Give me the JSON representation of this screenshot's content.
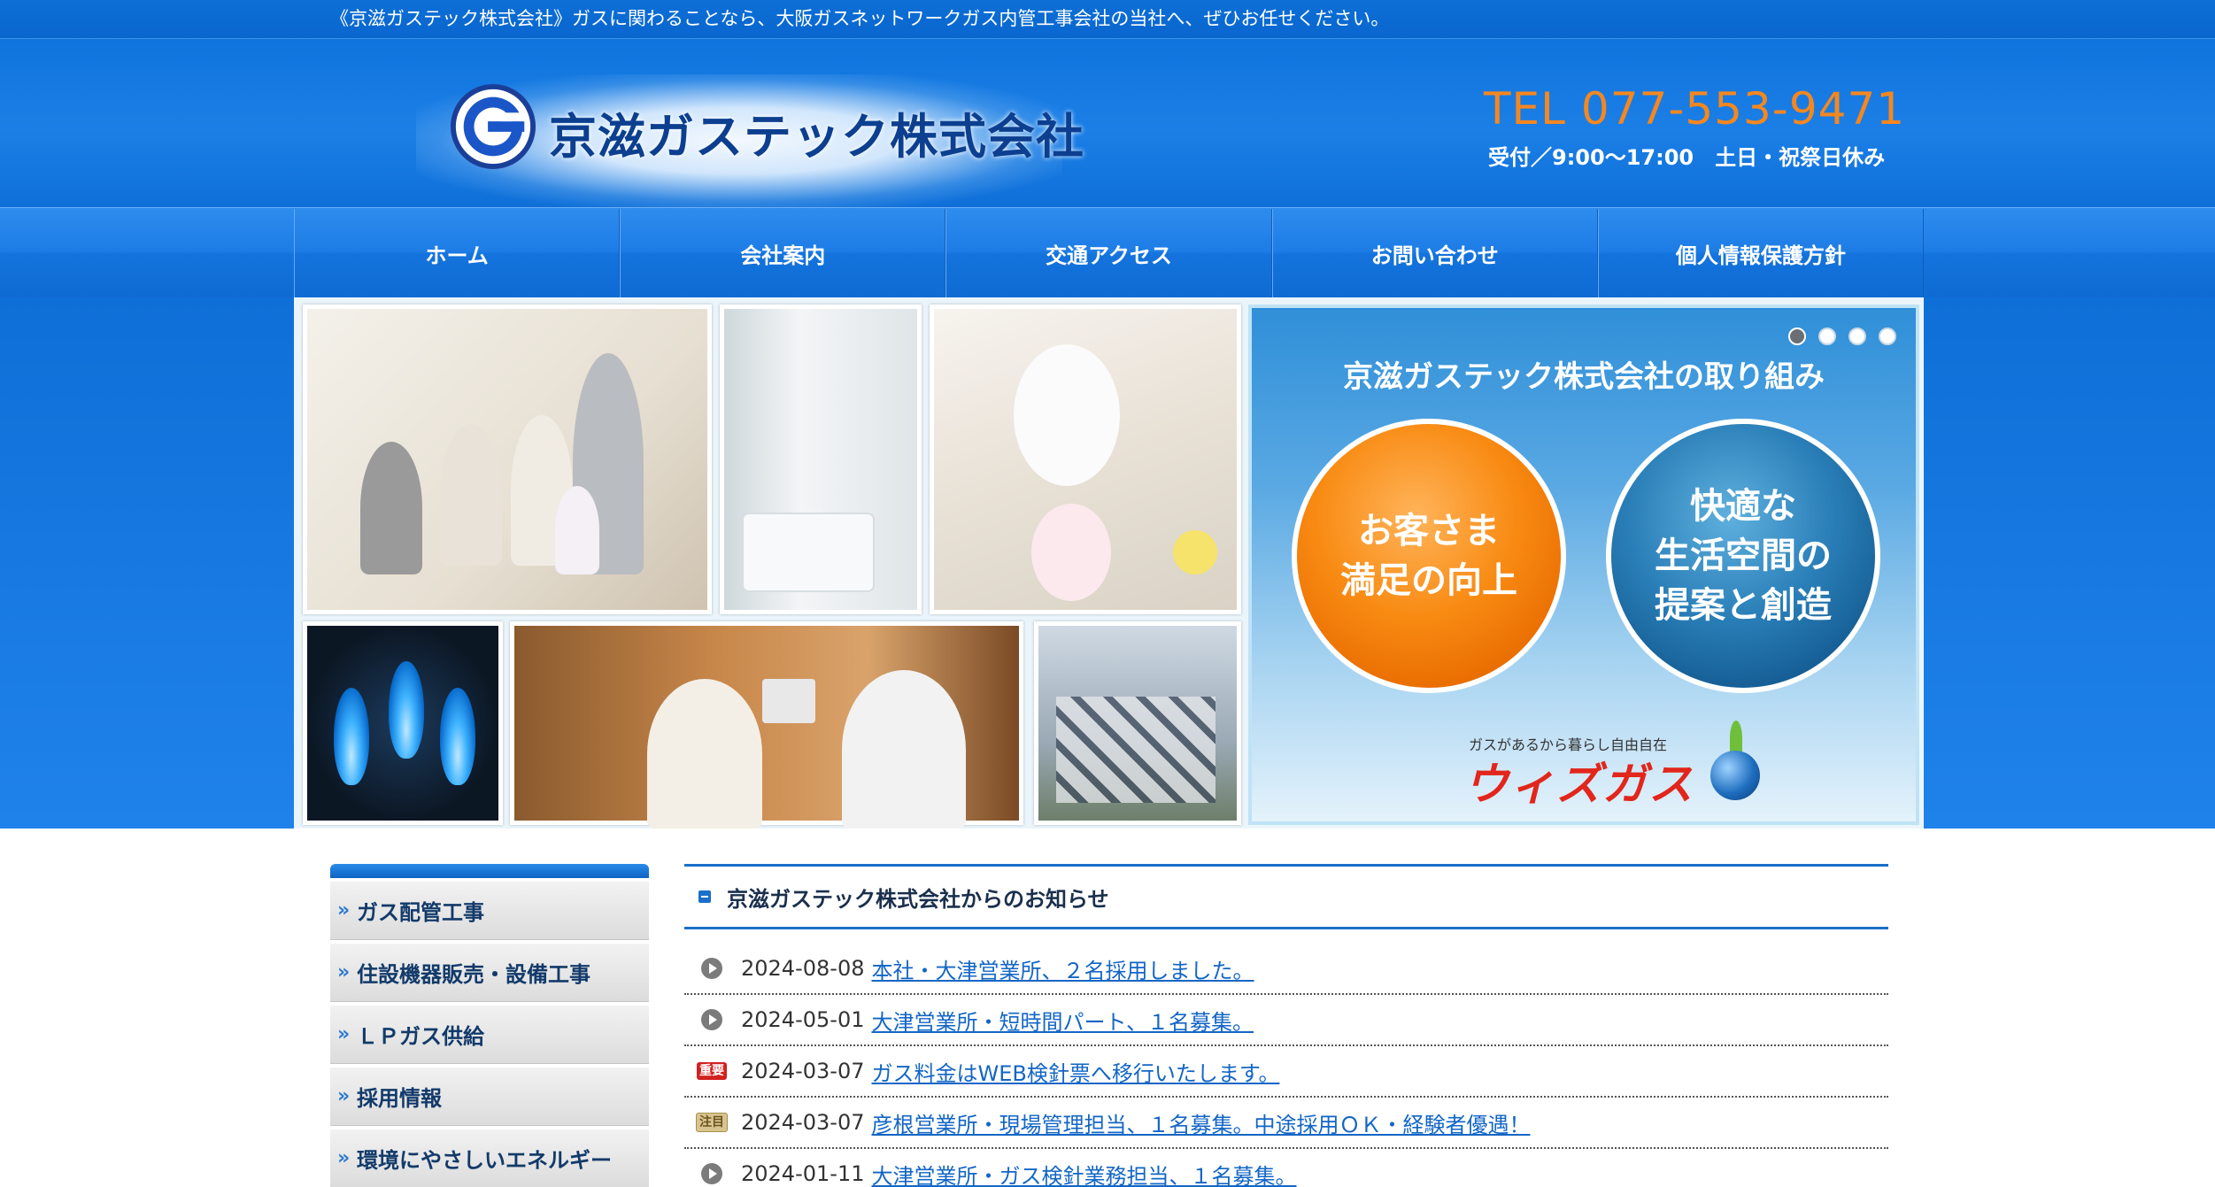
{
  "tagline": "《京滋ガステック株式会社》ガスに関わることなら、大阪ガスネットワークガス内管工事会社の当社へ、ぜひお任せください。",
  "header": {
    "company_name": "京滋ガステック株式会社",
    "tel": "TEL 077-553-9471",
    "hours": "受付／9:00～17:00　土日・祝祭日休み"
  },
  "nav": {
    "items": [
      {
        "label": "ホーム"
      },
      {
        "label": "会社案内"
      },
      {
        "label": "交通アクセス"
      },
      {
        "label": "お問い合わせ"
      },
      {
        "label": "個人情報保護方針"
      }
    ]
  },
  "slider": {
    "title": "京滋ガステック株式会社の取り組み",
    "circle_left_line1": "お客さま",
    "circle_left_line2": "満足の向上",
    "circle_right_line1": "快適な",
    "circle_right_line2": "生活空間の",
    "circle_right_line3": "提案と創造",
    "brand_small": "ガスがあるから暮らし自由自在",
    "brand_name": "ウィズガス",
    "dots": 4,
    "active_dot": 1
  },
  "sidebar": {
    "items": [
      {
        "label": "ガス配管工事"
      },
      {
        "label": "住設機器販売・設備工事"
      },
      {
        "label": "ＬＰガス供給"
      },
      {
        "label": "採用情報"
      },
      {
        "label": "環境にやさしいエネルギー"
      }
    ]
  },
  "news": {
    "title": "京滋ガステック株式会社からのお知らせ",
    "items": [
      {
        "date": "2024-08-08",
        "text": "本社・大津営業所、２名採用しました。",
        "icon": "arrow-circle-icon"
      },
      {
        "date": "2024-05-01",
        "text": "大津営業所・短時間パート、１名募集。",
        "icon": "arrow-circle-icon"
      },
      {
        "date": "2024-03-07",
        "text": "ガス料金はWEB検針票へ移行いたします。",
        "icon": "important-badge",
        "badge": "重要"
      },
      {
        "date": "2024-03-07",
        "text": "彦根営業所・現場管理担当、１名募集。中途採用ＯＫ・経験者優遇！",
        "icon": "attention-badge",
        "badge": "注目"
      },
      {
        "date": "2024-01-11",
        "text": "大津営業所・ガス検針業務担当、１名募集。",
        "icon": "arrow-circle-icon"
      }
    ]
  },
  "colors": {
    "header_blue": "#0f74dd",
    "tel_orange": "#f5871f",
    "link_blue": "#1366c5",
    "brand_red": "#e2261b"
  }
}
